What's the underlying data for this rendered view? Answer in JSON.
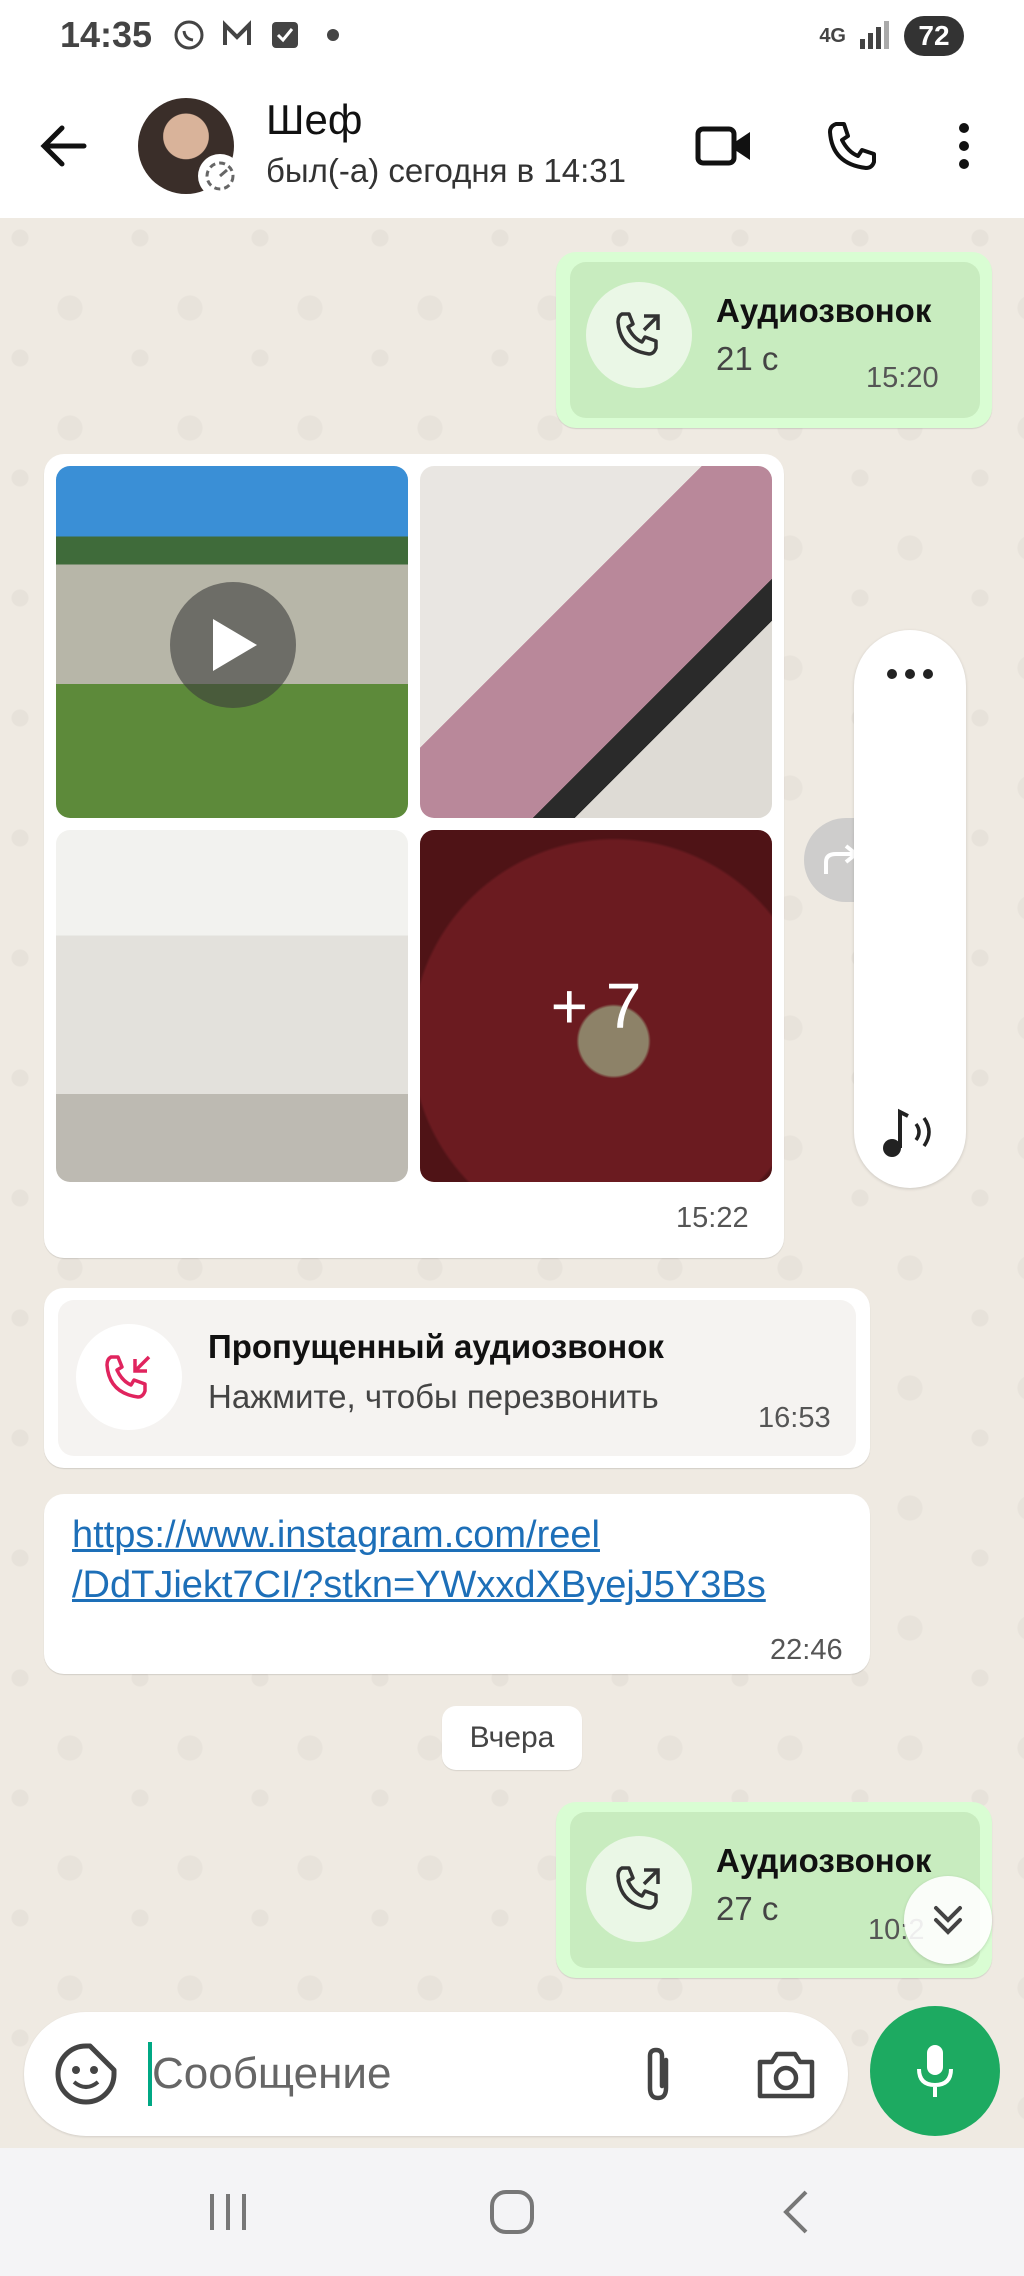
{
  "status_bar": {
    "time": "14:35",
    "network": "4G",
    "battery": "72"
  },
  "header": {
    "contact_name": "Шеф",
    "contact_status": "был(-а) сегодня в 14:31"
  },
  "messages": {
    "call_out_1": {
      "title": "Аудиозвонок",
      "duration": "21 с",
      "time": "15:20"
    },
    "media": {
      "more_count": "+ 7",
      "time": "15:22"
    },
    "missed_call": {
      "title": "Пропущенный аудиозвонок",
      "subtitle": "Нажмите, чтобы перезвонить",
      "time": "16:53"
    },
    "link": {
      "line1": "https://www.instagram.com/reel",
      "line2": "/DdTJiekt7CI/?stkn=YWxxdXByejJ5Y3Bs",
      "time": "22:46"
    },
    "date_separator": "Вчера",
    "call_out_2": {
      "title": "Аудиозвонок",
      "duration": "27 с",
      "time": "10:2"
    }
  },
  "input": {
    "placeholder": "Сообщение"
  },
  "colors": {
    "accent": "#1daa61",
    "outgoing_bubble": "#d9fdd3",
    "link": "#1d6fb8",
    "missed": "#e0245e"
  }
}
